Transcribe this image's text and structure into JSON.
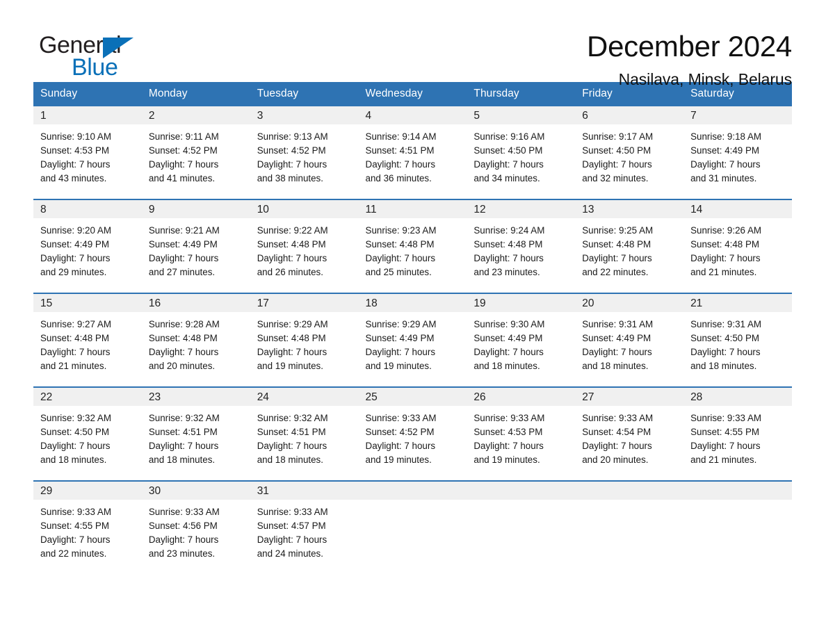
{
  "brand": {
    "name_part1": "General",
    "name_part2": "Blue",
    "triangle_color": "#0a70b8",
    "text_color": "#231f20"
  },
  "header": {
    "title": "December 2024",
    "subtitle": "Nasilava, Minsk, Belarus"
  },
  "theme": {
    "header_blue": "#2e73b3",
    "daynum_band": "#f0f0f0",
    "page_background": "#ffffff",
    "text": "#1a1a1a"
  },
  "weekday_headers": [
    "Sunday",
    "Monday",
    "Tuesday",
    "Wednesday",
    "Thursday",
    "Friday",
    "Saturday"
  ],
  "labels": {
    "sunrise_prefix": "Sunrise:",
    "sunset_prefix": "Sunset:",
    "daylight_prefix": "Daylight:"
  },
  "weeks": [
    [
      {
        "day": "1",
        "sunrise": "Sunrise: 9:10 AM",
        "sunset": "Sunset: 4:53 PM",
        "daylight_line1": "Daylight: 7 hours",
        "daylight_line2": "and 43 minutes."
      },
      {
        "day": "2",
        "sunrise": "Sunrise: 9:11 AM",
        "sunset": "Sunset: 4:52 PM",
        "daylight_line1": "Daylight: 7 hours",
        "daylight_line2": "and 41 minutes."
      },
      {
        "day": "3",
        "sunrise": "Sunrise: 9:13 AM",
        "sunset": "Sunset: 4:52 PM",
        "daylight_line1": "Daylight: 7 hours",
        "daylight_line2": "and 38 minutes."
      },
      {
        "day": "4",
        "sunrise": "Sunrise: 9:14 AM",
        "sunset": "Sunset: 4:51 PM",
        "daylight_line1": "Daylight: 7 hours",
        "daylight_line2": "and 36 minutes."
      },
      {
        "day": "5",
        "sunrise": "Sunrise: 9:16 AM",
        "sunset": "Sunset: 4:50 PM",
        "daylight_line1": "Daylight: 7 hours",
        "daylight_line2": "and 34 minutes."
      },
      {
        "day": "6",
        "sunrise": "Sunrise: 9:17 AM",
        "sunset": "Sunset: 4:50 PM",
        "daylight_line1": "Daylight: 7 hours",
        "daylight_line2": "and 32 minutes."
      },
      {
        "day": "7",
        "sunrise": "Sunrise: 9:18 AM",
        "sunset": "Sunset: 4:49 PM",
        "daylight_line1": "Daylight: 7 hours",
        "daylight_line2": "and 31 minutes."
      }
    ],
    [
      {
        "day": "8",
        "sunrise": "Sunrise: 9:20 AM",
        "sunset": "Sunset: 4:49 PM",
        "daylight_line1": "Daylight: 7 hours",
        "daylight_line2": "and 29 minutes."
      },
      {
        "day": "9",
        "sunrise": "Sunrise: 9:21 AM",
        "sunset": "Sunset: 4:49 PM",
        "daylight_line1": "Daylight: 7 hours",
        "daylight_line2": "and 27 minutes."
      },
      {
        "day": "10",
        "sunrise": "Sunrise: 9:22 AM",
        "sunset": "Sunset: 4:48 PM",
        "daylight_line1": "Daylight: 7 hours",
        "daylight_line2": "and 26 minutes."
      },
      {
        "day": "11",
        "sunrise": "Sunrise: 9:23 AM",
        "sunset": "Sunset: 4:48 PM",
        "daylight_line1": "Daylight: 7 hours",
        "daylight_line2": "and 25 minutes."
      },
      {
        "day": "12",
        "sunrise": "Sunrise: 9:24 AM",
        "sunset": "Sunset: 4:48 PM",
        "daylight_line1": "Daylight: 7 hours",
        "daylight_line2": "and 23 minutes."
      },
      {
        "day": "13",
        "sunrise": "Sunrise: 9:25 AM",
        "sunset": "Sunset: 4:48 PM",
        "daylight_line1": "Daylight: 7 hours",
        "daylight_line2": "and 22 minutes."
      },
      {
        "day": "14",
        "sunrise": "Sunrise: 9:26 AM",
        "sunset": "Sunset: 4:48 PM",
        "daylight_line1": "Daylight: 7 hours",
        "daylight_line2": "and 21 minutes."
      }
    ],
    [
      {
        "day": "15",
        "sunrise": "Sunrise: 9:27 AM",
        "sunset": "Sunset: 4:48 PM",
        "daylight_line1": "Daylight: 7 hours",
        "daylight_line2": "and 21 minutes."
      },
      {
        "day": "16",
        "sunrise": "Sunrise: 9:28 AM",
        "sunset": "Sunset: 4:48 PM",
        "daylight_line1": "Daylight: 7 hours",
        "daylight_line2": "and 20 minutes."
      },
      {
        "day": "17",
        "sunrise": "Sunrise: 9:29 AM",
        "sunset": "Sunset: 4:48 PM",
        "daylight_line1": "Daylight: 7 hours",
        "daylight_line2": "and 19 minutes."
      },
      {
        "day": "18",
        "sunrise": "Sunrise: 9:29 AM",
        "sunset": "Sunset: 4:49 PM",
        "daylight_line1": "Daylight: 7 hours",
        "daylight_line2": "and 19 minutes."
      },
      {
        "day": "19",
        "sunrise": "Sunrise: 9:30 AM",
        "sunset": "Sunset: 4:49 PM",
        "daylight_line1": "Daylight: 7 hours",
        "daylight_line2": "and 18 minutes."
      },
      {
        "day": "20",
        "sunrise": "Sunrise: 9:31 AM",
        "sunset": "Sunset: 4:49 PM",
        "daylight_line1": "Daylight: 7 hours",
        "daylight_line2": "and 18 minutes."
      },
      {
        "day": "21",
        "sunrise": "Sunrise: 9:31 AM",
        "sunset": "Sunset: 4:50 PM",
        "daylight_line1": "Daylight: 7 hours",
        "daylight_line2": "and 18 minutes."
      }
    ],
    [
      {
        "day": "22",
        "sunrise": "Sunrise: 9:32 AM",
        "sunset": "Sunset: 4:50 PM",
        "daylight_line1": "Daylight: 7 hours",
        "daylight_line2": "and 18 minutes."
      },
      {
        "day": "23",
        "sunrise": "Sunrise: 9:32 AM",
        "sunset": "Sunset: 4:51 PM",
        "daylight_line1": "Daylight: 7 hours",
        "daylight_line2": "and 18 minutes."
      },
      {
        "day": "24",
        "sunrise": "Sunrise: 9:32 AM",
        "sunset": "Sunset: 4:51 PM",
        "daylight_line1": "Daylight: 7 hours",
        "daylight_line2": "and 18 minutes."
      },
      {
        "day": "25",
        "sunrise": "Sunrise: 9:33 AM",
        "sunset": "Sunset: 4:52 PM",
        "daylight_line1": "Daylight: 7 hours",
        "daylight_line2": "and 19 minutes."
      },
      {
        "day": "26",
        "sunrise": "Sunrise: 9:33 AM",
        "sunset": "Sunset: 4:53 PM",
        "daylight_line1": "Daylight: 7 hours",
        "daylight_line2": "and 19 minutes."
      },
      {
        "day": "27",
        "sunrise": "Sunrise: 9:33 AM",
        "sunset": "Sunset: 4:54 PM",
        "daylight_line1": "Daylight: 7 hours",
        "daylight_line2": "and 20 minutes."
      },
      {
        "day": "28",
        "sunrise": "Sunrise: 9:33 AM",
        "sunset": "Sunset: 4:55 PM",
        "daylight_line1": "Daylight: 7 hours",
        "daylight_line2": "and 21 minutes."
      }
    ],
    [
      {
        "day": "29",
        "sunrise": "Sunrise: 9:33 AM",
        "sunset": "Sunset: 4:55 PM",
        "daylight_line1": "Daylight: 7 hours",
        "daylight_line2": "and 22 minutes."
      },
      {
        "day": "30",
        "sunrise": "Sunrise: 9:33 AM",
        "sunset": "Sunset: 4:56 PM",
        "daylight_line1": "Daylight: 7 hours",
        "daylight_line2": "and 23 minutes."
      },
      {
        "day": "31",
        "sunrise": "Sunrise: 9:33 AM",
        "sunset": "Sunset: 4:57 PM",
        "daylight_line1": "Daylight: 7 hours",
        "daylight_line2": "and 24 minutes."
      },
      {
        "day": "",
        "sunrise": "",
        "sunset": "",
        "daylight_line1": "",
        "daylight_line2": ""
      },
      {
        "day": "",
        "sunrise": "",
        "sunset": "",
        "daylight_line1": "",
        "daylight_line2": ""
      },
      {
        "day": "",
        "sunrise": "",
        "sunset": "",
        "daylight_line1": "",
        "daylight_line2": ""
      },
      {
        "day": "",
        "sunrise": "",
        "sunset": "",
        "daylight_line1": "",
        "daylight_line2": ""
      }
    ]
  ]
}
